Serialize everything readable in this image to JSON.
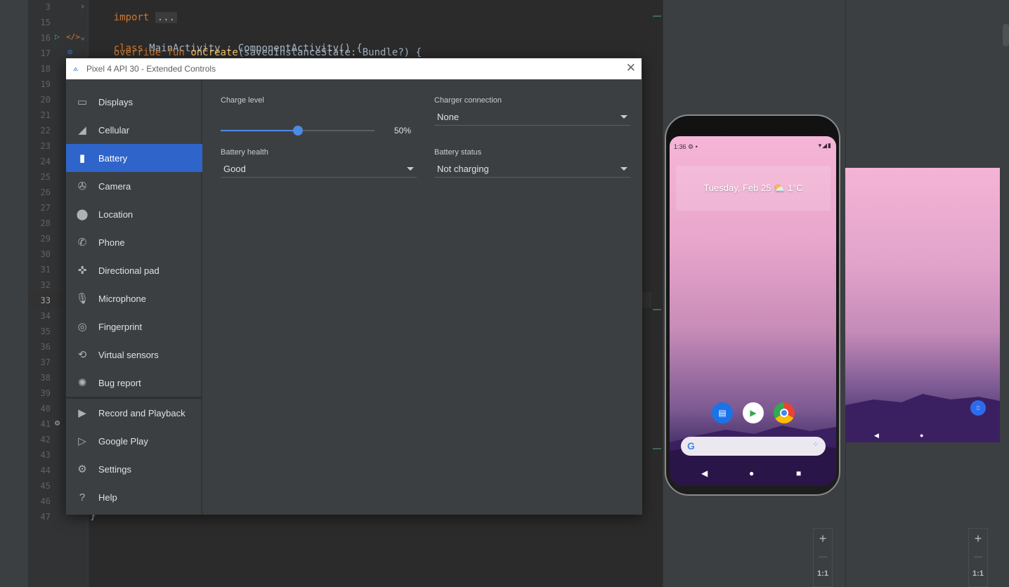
{
  "editor": {
    "lines": [
      {
        "n": "3"
      },
      {
        "n": "15"
      },
      {
        "n": "16"
      },
      {
        "n": "17"
      },
      {
        "n": "18"
      },
      {
        "n": "19"
      },
      {
        "n": "20"
      },
      {
        "n": "21"
      },
      {
        "n": "22"
      },
      {
        "n": "23"
      },
      {
        "n": "24"
      },
      {
        "n": "25"
      },
      {
        "n": "26"
      },
      {
        "n": "27"
      },
      {
        "n": "28"
      },
      {
        "n": "29"
      },
      {
        "n": "30"
      },
      {
        "n": "31"
      },
      {
        "n": "32"
      },
      {
        "n": "33"
      },
      {
        "n": "34"
      },
      {
        "n": "35"
      },
      {
        "n": "36"
      },
      {
        "n": "37"
      },
      {
        "n": "38"
      },
      {
        "n": "39"
      },
      {
        "n": "40"
      },
      {
        "n": "41"
      },
      {
        "n": "42"
      },
      {
        "n": "43"
      },
      {
        "n": "44"
      },
      {
        "n": "45"
      },
      {
        "n": "46"
      },
      {
        "n": "47"
      }
    ],
    "code_import_kw": "import",
    "code_import_fold": "...",
    "code_class_kw": "class",
    "code_class_rest": " MainActivity : ComponentActivity() {",
    "code_override_kw": "override fun",
    "code_fun_name": "onCreate",
    "code_fun_rest": "(savedInstanceState: Bundle?) {",
    "code_closing": "}"
  },
  "window": {
    "title": "Pixel 4 API 30 - Extended Controls",
    "close_glyph": "✕"
  },
  "sidebar": {
    "items": [
      {
        "label": "Displays",
        "icon": "monitor-icon",
        "glyph": "▭"
      },
      {
        "label": "Cellular",
        "icon": "signal-icon",
        "glyph": "◢"
      },
      {
        "label": "Battery",
        "icon": "battery-icon",
        "glyph": "▮"
      },
      {
        "label": "Camera",
        "icon": "camera-aperture-icon",
        "glyph": "✇"
      },
      {
        "label": "Location",
        "icon": "location-pin-icon",
        "glyph": "⬤"
      },
      {
        "label": "Phone",
        "icon": "phone-icon",
        "glyph": "✆"
      },
      {
        "label": "Directional pad",
        "icon": "dpad-icon",
        "glyph": "✜"
      },
      {
        "label": "Microphone",
        "icon": "microphone-icon",
        "glyph": "🎙"
      },
      {
        "label": "Fingerprint",
        "icon": "fingerprint-icon",
        "glyph": "◎"
      },
      {
        "label": "Virtual sensors",
        "icon": "rotation-icon",
        "glyph": "⟲"
      },
      {
        "label": "Bug report",
        "icon": "bug-icon",
        "glyph": "✺"
      },
      {
        "label": "Record and Playback",
        "icon": "video-camera-icon",
        "glyph": "▶"
      },
      {
        "label": "Google Play",
        "icon": "play-store-icon",
        "glyph": "▷"
      },
      {
        "label": "Settings",
        "icon": "gear-icon",
        "glyph": "⚙"
      },
      {
        "label": "Help",
        "icon": "help-icon",
        "glyph": "?"
      }
    ],
    "active": "Battery"
  },
  "battery": {
    "charge_level_label": "Charge level",
    "charge_level_value": 50,
    "charge_level_text": "50%",
    "charger_connection_label": "Charger connection",
    "charger_connection_value": "None",
    "battery_health_label": "Battery health",
    "battery_health_value": "Good",
    "battery_status_label": "Battery status",
    "battery_status_value": "Not charging"
  },
  "phone": {
    "status_time": "1:36",
    "date_widget": "Tuesday, Feb 25 ⛅ 1°C"
  },
  "zoom": {
    "plus": "+",
    "minus": "—",
    "ratio": "1:1"
  },
  "colors": {
    "accent": "#2f65ca",
    "slider": "#4d8be2"
  }
}
